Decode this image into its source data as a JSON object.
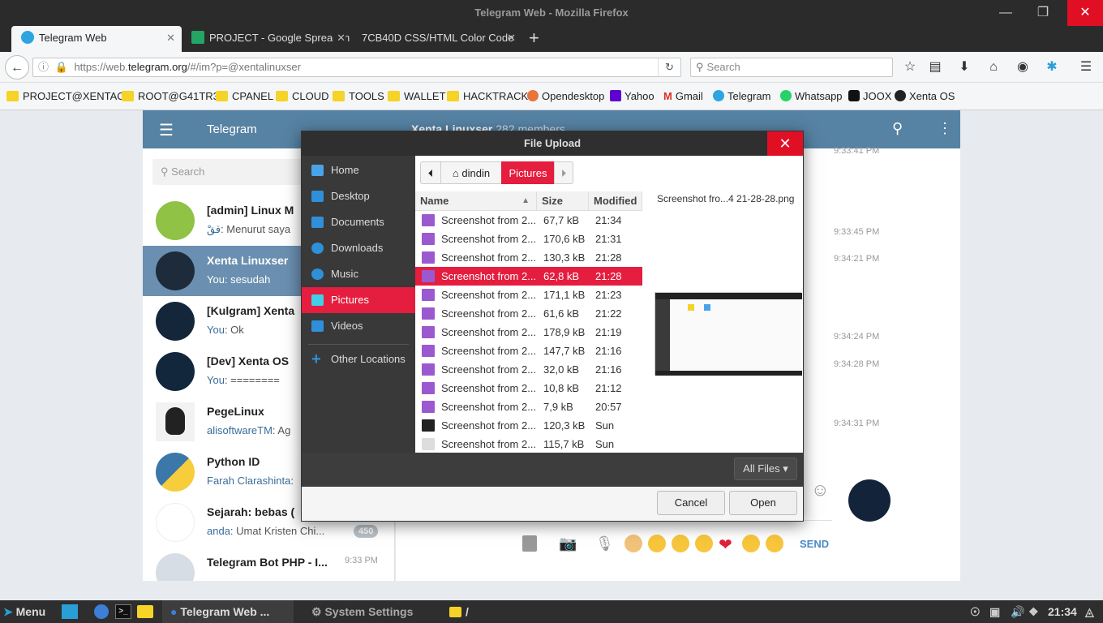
{
  "window": {
    "title": "Telegram Web - Mozilla Firefox"
  },
  "tabs": [
    {
      "label": "Telegram Web"
    },
    {
      "label": "PROJECT - Google Spreadsh"
    },
    {
      "label": "7CB40D CSS/HTML Color Code"
    }
  ],
  "nav": {
    "url_prefix": "https://web.",
    "url_domain": "telegram.org",
    "url_suffix": "/#/im?p=@xentalinuxser",
    "search_placeholder": "Search"
  },
  "bookmarks": [
    "PROJECT@XENTAOS",
    "ROOT@G41TR3",
    "CPANEL",
    "CLOUD",
    "TOOLS",
    "WALLET",
    "HACKTRACK",
    "Opendesktop",
    "Yahoo",
    "Gmail",
    "Telegram",
    "Whatsapp",
    "JOOX",
    "Xenta OS"
  ],
  "telegram": {
    "app_title": "Telegram",
    "chat_title": "Xenta Linuxser",
    "chat_members": "282 members",
    "search_placeholder": "Search",
    "send_label": "SEND",
    "chats": [
      {
        "name": "[admin] Linux M",
        "msg_prefix": "ققْ",
        "msg": ": Menurut saya"
      },
      {
        "name": "Xenta Linuxser",
        "msg_prefix": "You",
        "msg": ": sesudah"
      },
      {
        "name": "[Kulgram] Xenta",
        "msg_prefix": "You",
        "msg": ": Ok"
      },
      {
        "name": "[Dev] Xenta OS",
        "msg_prefix": "You",
        "msg": ": ========"
      },
      {
        "name": "PegeLinux",
        "msg_prefix": "alisoftwareTM",
        "msg": ": Ag"
      },
      {
        "name": "Python ID",
        "msg_prefix": "Farah Clarashinta",
        "msg": ":"
      },
      {
        "name": "Sejarah: bebas (",
        "msg_prefix": "anda",
        "msg": ": Umat Kristen Chi..."
      },
      {
        "name": "Telegram Bot PHP - I...",
        "msg_prefix": "",
        "msg": ""
      }
    ],
    "unread_badge": "450",
    "bot_time": "9:33 PM",
    "times": [
      "9:33:41 PM",
      "9:33:45 PM",
      "9:34:21 PM",
      "9:34:24 PM",
      "9:34:28 PM",
      "9:34:31 PM"
    ]
  },
  "dialog": {
    "title": "File Upload",
    "places": [
      "Home",
      "Desktop",
      "Documents",
      "Downloads",
      "Music",
      "Pictures",
      "Videos",
      "Other Locations"
    ],
    "selected_place": "Pictures",
    "path": [
      "dindin",
      "Pictures"
    ],
    "columns": {
      "name": "Name",
      "size": "Size",
      "modified": "Modified"
    },
    "files": [
      {
        "name": "Screenshot from 2...",
        "size": "67,7 kB",
        "modified": "21:34"
      },
      {
        "name": "Screenshot from 2...",
        "size": "170,6 kB",
        "modified": "21:31"
      },
      {
        "name": "Screenshot from 2...",
        "size": "130,3 kB",
        "modified": "21:28"
      },
      {
        "name": "Screenshot from 2...",
        "size": "62,8 kB",
        "modified": "21:28"
      },
      {
        "name": "Screenshot from 2...",
        "size": "171,1 kB",
        "modified": "21:23"
      },
      {
        "name": "Screenshot from 2...",
        "size": "61,6 kB",
        "modified": "21:22"
      },
      {
        "name": "Screenshot from 2...",
        "size": "178,9 kB",
        "modified": "21:19"
      },
      {
        "name": "Screenshot from 2...",
        "size": "147,7 kB",
        "modified": "21:16"
      },
      {
        "name": "Screenshot from 2...",
        "size": "32,0 kB",
        "modified": "21:16"
      },
      {
        "name": "Screenshot from 2...",
        "size": "10,8 kB",
        "modified": "21:12"
      },
      {
        "name": "Screenshot from 2...",
        "size": "7,9 kB",
        "modified": "20:57"
      },
      {
        "name": "Screenshot from 2...",
        "size": "120,3 kB",
        "modified": "Sun"
      },
      {
        "name": "Screenshot from 2...",
        "size": "115,7 kB",
        "modified": "Sun"
      }
    ],
    "selected_file_index": 3,
    "preview_name": "Screenshot fro...4 21-28-28.png",
    "filter": "All Files",
    "cancel": "Cancel",
    "open": "Open"
  },
  "taskbar": {
    "menu": "Menu",
    "task_telegram": "Telegram Web ...",
    "task_settings": "System Settings",
    "task_folder": "/",
    "clock": "21:34"
  },
  "colors": {
    "accent": "#e51d3e",
    "telegram_header": "#5682a3"
  }
}
